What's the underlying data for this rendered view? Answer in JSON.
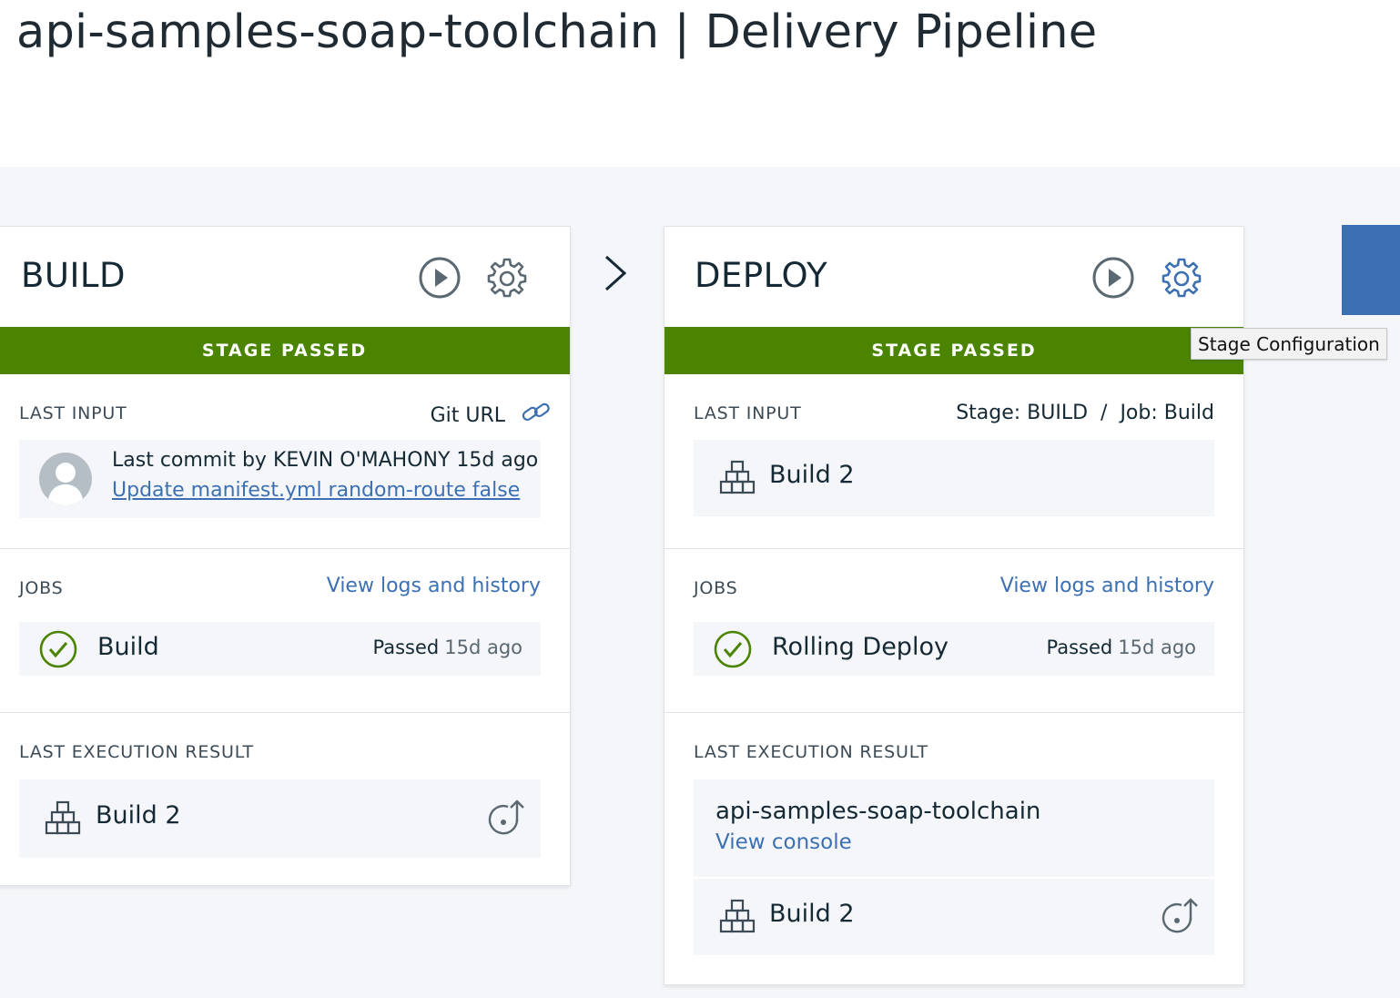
{
  "page": {
    "title": "api-samples-soap-toolchain | Delivery Pipeline"
  },
  "tooltip": {
    "text": "Stage Configuration"
  },
  "stages": [
    {
      "name": "BUILD",
      "status": "STAGE PASSED",
      "last_input": {
        "label": "LAST INPUT",
        "source": "Git URL",
        "commit_text": "Last commit by KEVIN O'MAHONY 15d ago",
        "commit_message": "Update manifest.yml random-route false"
      },
      "jobs": {
        "label": "JOBS",
        "view_logs": "View logs and history",
        "items": [
          {
            "name": "Build",
            "status": "Passed",
            "ago": "15d ago"
          }
        ]
      },
      "last_execution": {
        "label": "LAST EXECUTION RESULT",
        "build": "Build 2"
      }
    },
    {
      "name": "DEPLOY",
      "status": "STAGE PASSED",
      "last_input": {
        "label": "LAST INPUT",
        "source": "Stage: BUILD  /  Job: Build",
        "build": "Build 2"
      },
      "jobs": {
        "label": "JOBS",
        "view_logs": "View logs and history",
        "items": [
          {
            "name": "Rolling Deploy",
            "status": "Passed",
            "ago": "15d ago"
          }
        ]
      },
      "last_execution": {
        "label": "LAST EXECUTION RESULT",
        "app_name": "api-samples-soap-toolchain",
        "view_console": "View console",
        "build": "Build 2"
      }
    }
  ],
  "colors": {
    "passed": "#4b8400",
    "link": "#3d70b2",
    "canvas": "#f4f6f9"
  }
}
